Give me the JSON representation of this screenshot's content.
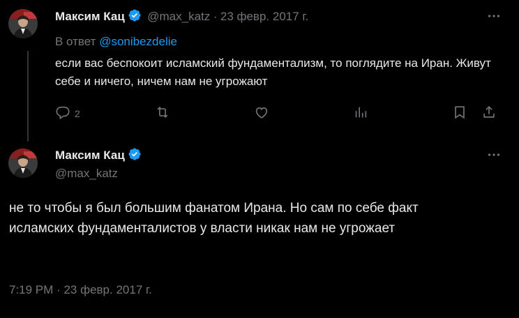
{
  "reply_tweet": {
    "author_name": "Максим Кац",
    "handle": "@max_katz",
    "separator": "·",
    "date": "23 февр. 2017 г.",
    "reply_prefix": "В ответ",
    "reply_to": "@sonibezdelie",
    "text": "если вас беспокоит исламский фундаментализм, то поглядите на Иран. Живут себе и ничего, ничем нам не угрожают",
    "reply_count": "2"
  },
  "main_tweet": {
    "author_name": "Максим Кац",
    "handle": "@max_katz",
    "text": "не то чтобы я был большим фанатом Ирана. Но сам по себе факт исламских фундаменталистов у власти никак нам не угрожает",
    "time": "7:19 PM",
    "separator": "·",
    "date": "23 февр. 2017 г."
  },
  "icons": [
    "avatar",
    "verified-badge-icon",
    "more-icon",
    "reply-icon",
    "retweet-icon",
    "like-icon",
    "views-icon",
    "bookmark-icon",
    "share-icon"
  ],
  "colors": {
    "background": "#000000",
    "text": "#e7e9ea",
    "muted": "#71767b",
    "accent": "#1d9bf0"
  }
}
